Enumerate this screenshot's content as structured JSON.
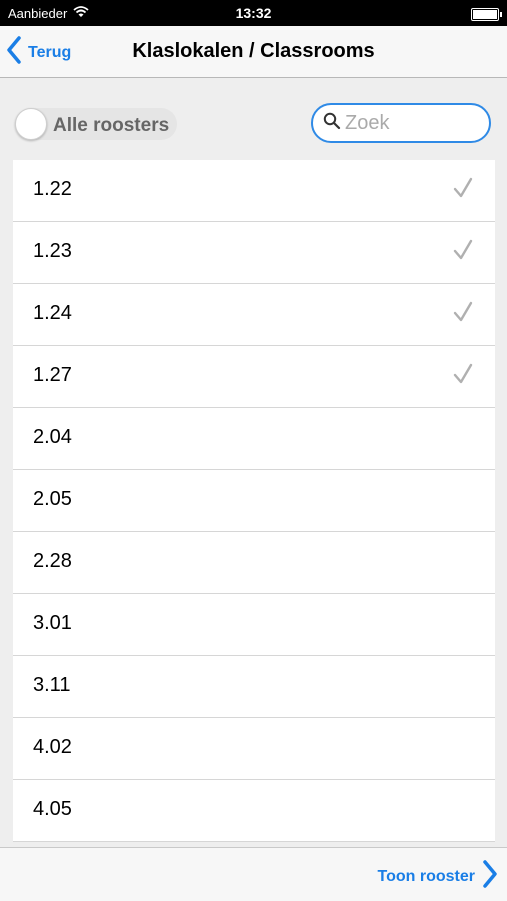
{
  "status_bar": {
    "carrier": "Aanbieder",
    "time": "13:32"
  },
  "nav": {
    "back_label": "Terug",
    "title": "Klaslokalen / Classrooms"
  },
  "filter": {
    "toggle_label": "Alle roosters",
    "toggle_on": false,
    "search_placeholder": "Zoek",
    "search_value": ""
  },
  "rooms": [
    {
      "label": "1.22",
      "checked": true
    },
    {
      "label": "1.23",
      "checked": true
    },
    {
      "label": "1.24",
      "checked": true
    },
    {
      "label": "1.27",
      "checked": true
    },
    {
      "label": "2.04",
      "checked": false
    },
    {
      "label": "2.05",
      "checked": false
    },
    {
      "label": "2.28",
      "checked": false
    },
    {
      "label": "3.01",
      "checked": false
    },
    {
      "label": "3.11",
      "checked": false
    },
    {
      "label": "4.02",
      "checked": false
    },
    {
      "label": "4.05",
      "checked": false
    }
  ],
  "footer": {
    "show_label": "Toon rooster"
  },
  "colors": {
    "accent": "#1a7ee6",
    "check": "#b0b0b0",
    "background": "#eeeeee"
  }
}
